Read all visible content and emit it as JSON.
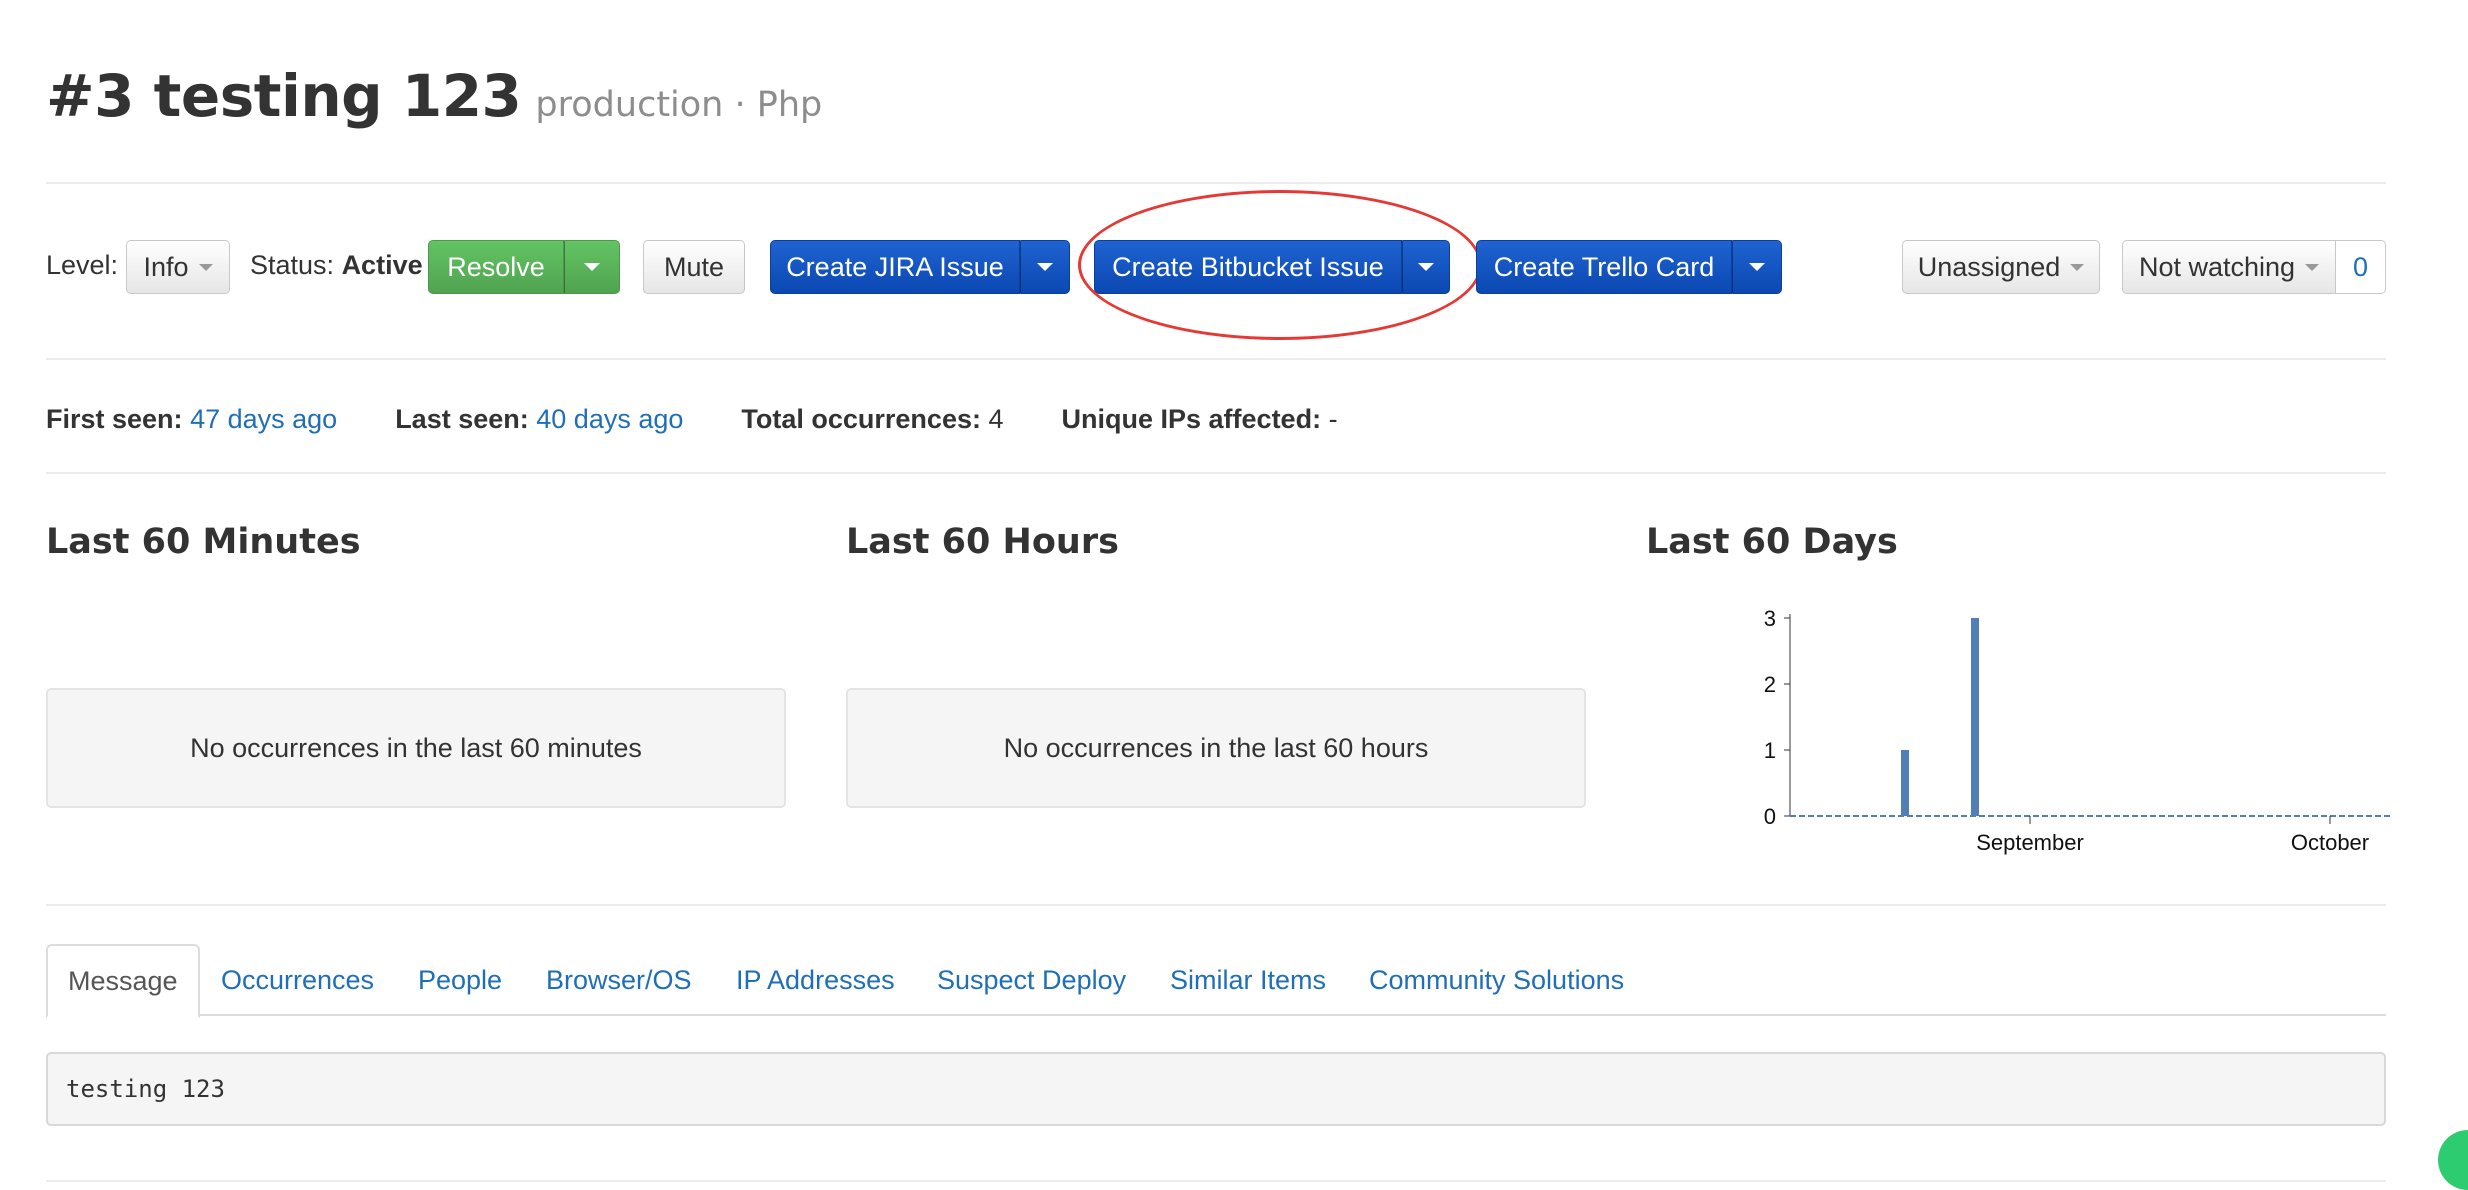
{
  "header": {
    "title": "#3 testing 123",
    "subtitle": "production · Php"
  },
  "toolbar": {
    "level_label": "Level:",
    "level_value": "Info",
    "status_label": "Status:",
    "status_value": "Active",
    "resolve_label": "Resolve",
    "mute_label": "Mute",
    "jira_label": "Create JIRA Issue",
    "bitbucket_label": "Create Bitbucket Issue",
    "trello_label": "Create Trello Card",
    "assign_label": "Unassigned",
    "watch_label": "Not watching",
    "watch_count": "0"
  },
  "meta": {
    "first_seen_label": "First seen:",
    "first_seen_value": "47 days ago",
    "last_seen_label": "Last seen:",
    "last_seen_value": "40 days ago",
    "total_label": "Total occurrences:",
    "total_value": "4",
    "ips_label": "Unique IPs affected:",
    "ips_value": "-"
  },
  "sections": {
    "minutes_title": "Last 60 Minutes",
    "minutes_empty": "No occurrences in the last 60 minutes",
    "hours_title": "Last 60 Hours",
    "hours_empty": "No occurrences in the last 60 hours",
    "days_title": "Last 60 Days"
  },
  "chart_data": {
    "type": "bar",
    "title": "Last 60 Days",
    "xlabel": "",
    "ylabel": "",
    "ylim": [
      0,
      3
    ],
    "yticks": [
      "0",
      "1",
      "2",
      "3"
    ],
    "xticks": [
      "September",
      "October"
    ],
    "x_range_days": [
      0,
      60
    ],
    "xtick_days": [
      24,
      54
    ],
    "bars": [
      {
        "day": 11.5,
        "value": 1
      },
      {
        "day": 18.5,
        "value": 3
      }
    ],
    "color": "#4f7fb5",
    "grid": false
  },
  "tabs": [
    {
      "label": "Message"
    },
    {
      "label": "Occurrences"
    },
    {
      "label": "People"
    },
    {
      "label": "Browser/OS"
    },
    {
      "label": "IP Addresses"
    },
    {
      "label": "Suspect Deploy"
    },
    {
      "label": "Similar Items"
    },
    {
      "label": "Community Solutions"
    }
  ],
  "message": {
    "text": "testing 123"
  },
  "colors": {
    "link": "#1f6fb8",
    "primary_blue": "#0b48b2",
    "success_green": "#51a351",
    "highlight_red": "#e53935"
  }
}
